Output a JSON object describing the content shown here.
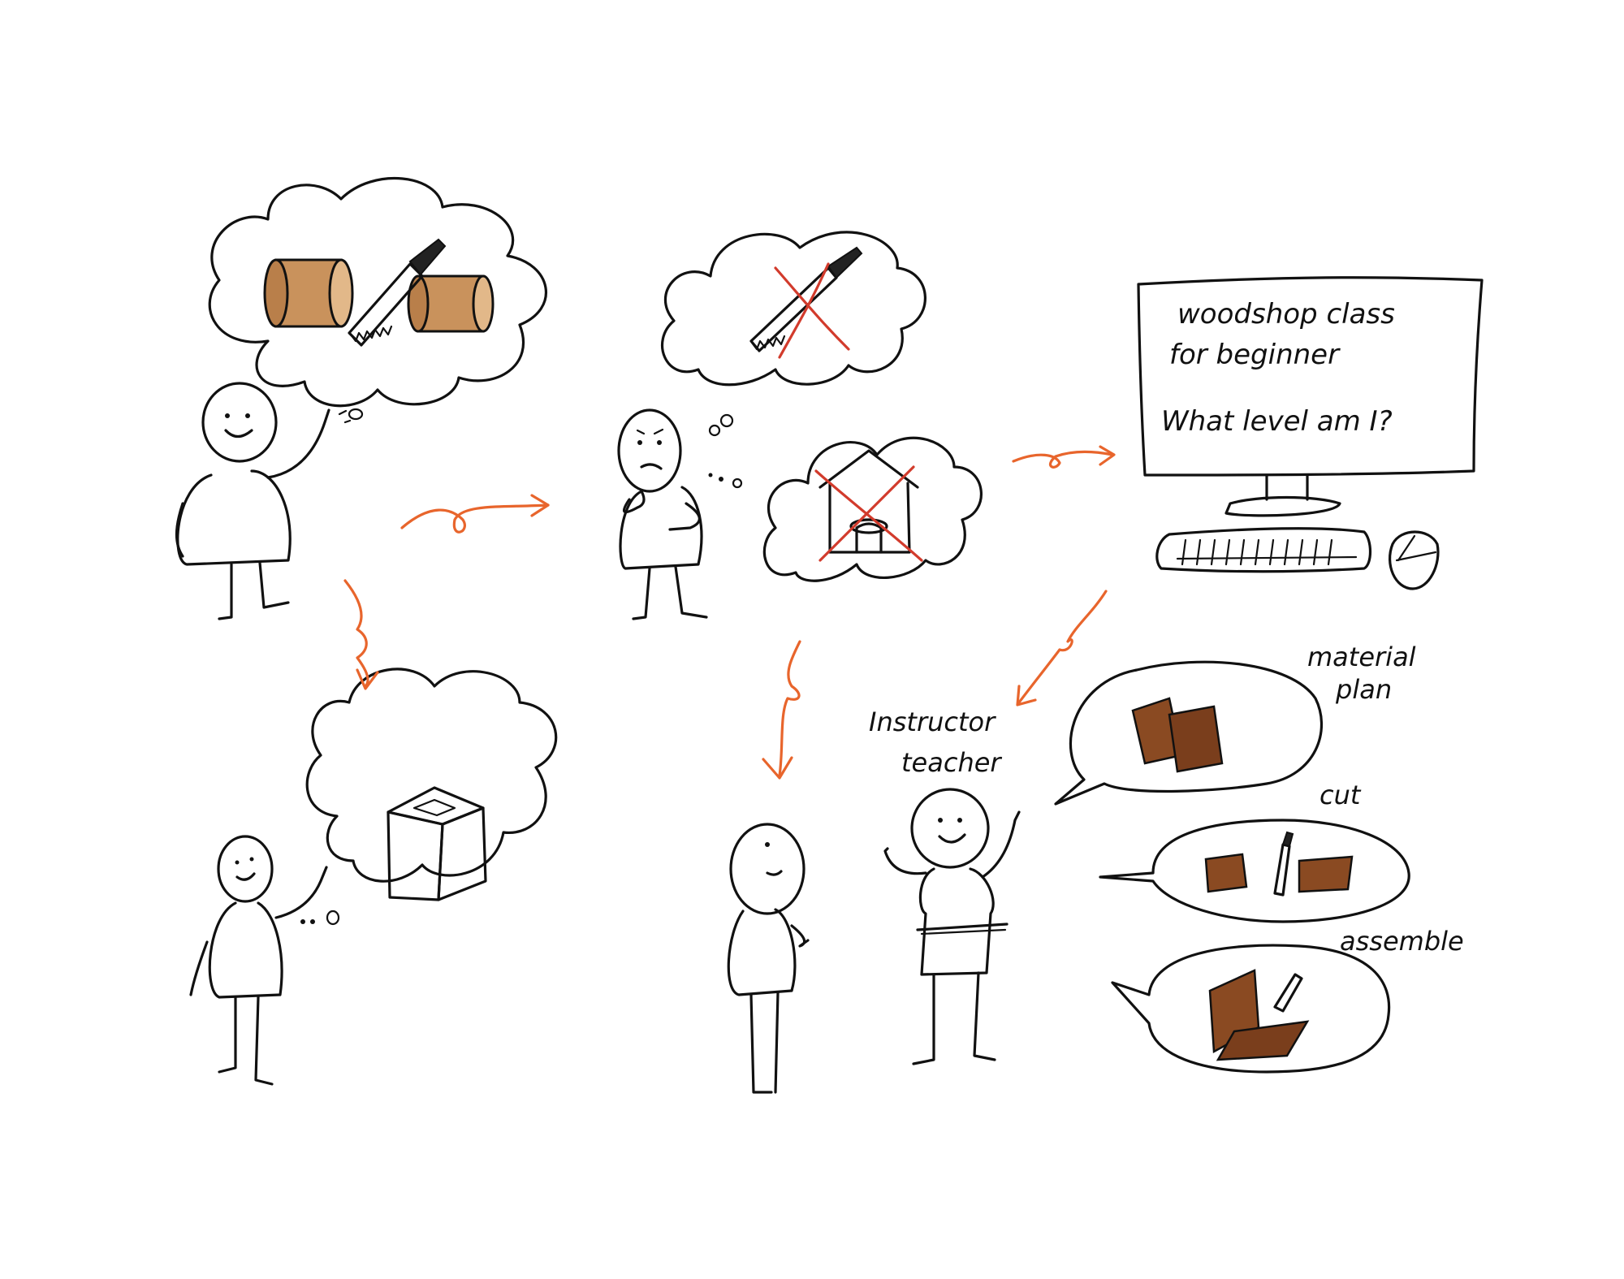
{
  "monitor": {
    "line1": "woodshop class",
    "line2": "for beginner",
    "line3": "What level am I?"
  },
  "labels": {
    "instructor": "Instructor",
    "teacher": "teacher",
    "material": "material",
    "plan": "plan",
    "cut": "cut",
    "assemble": "assemble"
  },
  "colors": {
    "ink": "#111111",
    "arrow": "#e8652c",
    "cross": "#d23b2c",
    "wood_light": "#c9925c",
    "wood_dark": "#8a4a22"
  }
}
